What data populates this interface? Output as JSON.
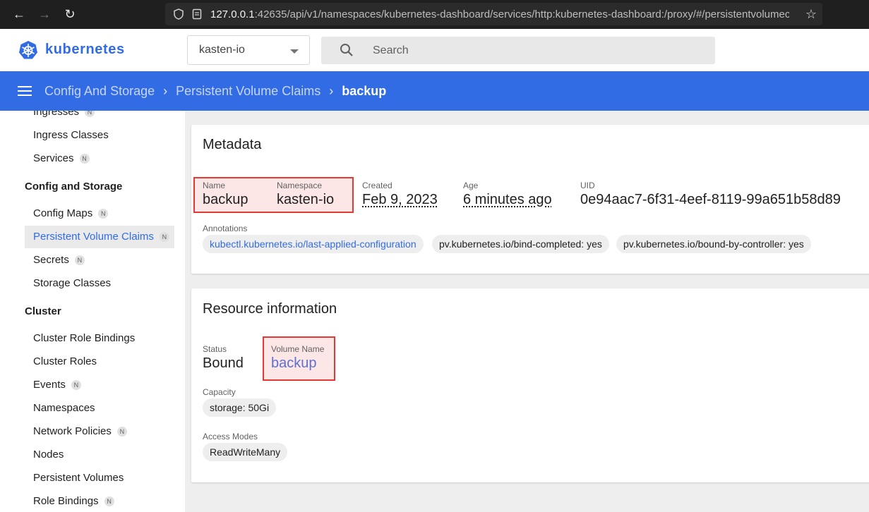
{
  "browser": {
    "url_host": "127.0.0.1",
    "url_rest": ":42635/api/v1/namespaces/kubernetes-dashboard/services/http:kubernetes-dashboard:/proxy/#/persistentvolumeclaim/k"
  },
  "header": {
    "brand": "kubernetes",
    "namespace": "kasten-io",
    "search_placeholder": "Search"
  },
  "breadcrumb": {
    "items": [
      "Config And Storage",
      "Persistent Volume Claims"
    ],
    "current": "backup"
  },
  "sidebar": {
    "items": [
      {
        "label": "Ingresses",
        "badge": "N"
      },
      {
        "label": "Ingress Classes",
        "badge": ""
      },
      {
        "label": "Services",
        "badge": "N"
      },
      {
        "label": "Config and Storage",
        "heading": true
      },
      {
        "label": "Config Maps",
        "badge": "N"
      },
      {
        "label": "Persistent Volume Claims",
        "badge": "N",
        "active": true
      },
      {
        "label": "Secrets",
        "badge": "N"
      },
      {
        "label": "Storage Classes",
        "badge": ""
      },
      {
        "label": "Cluster",
        "heading": true
      },
      {
        "label": "Cluster Role Bindings",
        "badge": ""
      },
      {
        "label": "Cluster Roles",
        "badge": ""
      },
      {
        "label": "Events",
        "badge": "N"
      },
      {
        "label": "Namespaces",
        "badge": ""
      },
      {
        "label": "Network Policies",
        "badge": "N"
      },
      {
        "label": "Nodes",
        "badge": ""
      },
      {
        "label": "Persistent Volumes",
        "badge": ""
      },
      {
        "label": "Role Bindings",
        "badge": "N"
      }
    ]
  },
  "metadata": {
    "title": "Metadata",
    "name_label": "Name",
    "name": "backup",
    "namespace_label": "Namespace",
    "namespace": "kasten-io",
    "created_label": "Created",
    "created": "Feb 9, 2023",
    "age_label": "Age",
    "age": "6 minutes ago",
    "uid_label": "UID",
    "uid": "0e94aac7-6f31-4eef-8119-99a651b58d89",
    "annotations_label": "Annotations",
    "annotations": [
      "kubectl.kubernetes.io/last-applied-configuration",
      "pv.kubernetes.io/bind-completed: yes",
      "pv.kubernetes.io/bound-by-controller: yes"
    ]
  },
  "resource": {
    "title": "Resource information",
    "status_label": "Status",
    "status": "Bound",
    "volume_label": "Volume Name",
    "volume": "backup",
    "capacity_label": "Capacity",
    "capacity": "storage: 50Gi",
    "access_label": "Access Modes",
    "access": "ReadWriteMany"
  },
  "colors": {
    "accent": "#326ce5",
    "highlight": "#e53935"
  }
}
